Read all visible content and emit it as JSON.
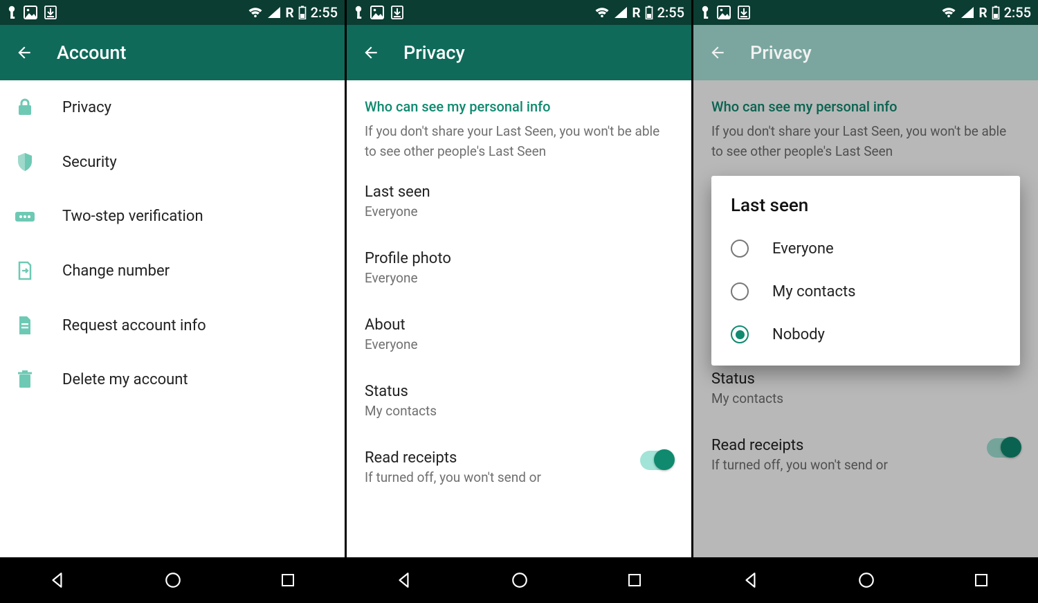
{
  "statusbar": {
    "time": "2:55",
    "network_letter": "R"
  },
  "screen1": {
    "title": "Account",
    "items": [
      {
        "label": "Privacy"
      },
      {
        "label": "Security"
      },
      {
        "label": "Two-step verification"
      },
      {
        "label": "Change number"
      },
      {
        "label": "Request account info"
      },
      {
        "label": "Delete my account"
      }
    ]
  },
  "screen2": {
    "title": "Privacy",
    "section_header": "Who can see my personal info",
    "section_desc": "If you don't share your Last Seen, you won't be able to see other people's Last Seen",
    "settings": [
      {
        "title": "Last seen",
        "sub": "Everyone"
      },
      {
        "title": "Profile photo",
        "sub": "Everyone"
      },
      {
        "title": "About",
        "sub": "Everyone"
      },
      {
        "title": "Status",
        "sub": "My contacts"
      }
    ],
    "read_receipts": {
      "title": "Read receipts",
      "sub": "If turned off, you won't send or"
    }
  },
  "screen3": {
    "title": "Privacy",
    "section_header": "Who can see my personal info",
    "section_desc": "If you don't share your Last Seen, you won't be able to see other people's Last Seen",
    "status_title": "Status",
    "status_sub": "My contacts",
    "read_receipts": {
      "title": "Read receipts",
      "sub": "If turned off, you won't send or"
    },
    "dialog": {
      "title": "Last seen",
      "options": [
        {
          "label": "Everyone",
          "checked": false
        },
        {
          "label": "My contacts",
          "checked": false
        },
        {
          "label": "Nobody",
          "checked": true
        }
      ]
    }
  }
}
